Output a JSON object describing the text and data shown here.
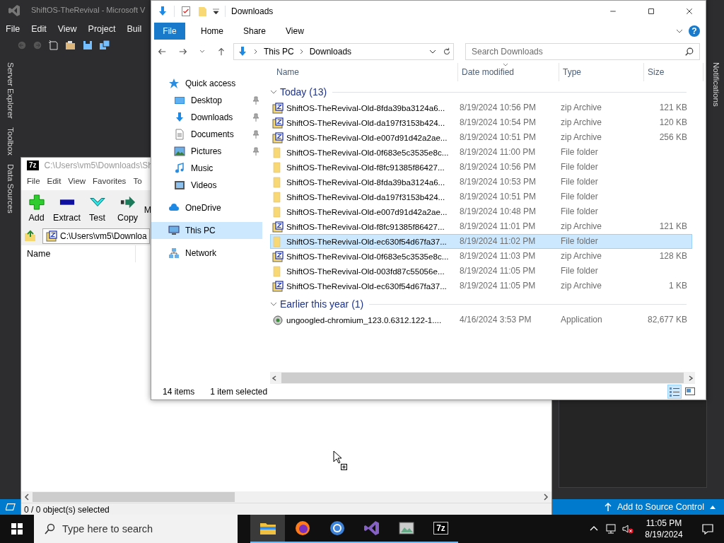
{
  "vs": {
    "title": "ShiftOS-TheRevival - Microsoft V",
    "menu": [
      "File",
      "Edit",
      "View",
      "Project",
      "Buil"
    ],
    "left_tabs": [
      "Server Explorer",
      "Toolbox",
      "Data Sources"
    ],
    "right_tabs": [
      "Notifications"
    ],
    "status_action": "Add to Source Control"
  },
  "sevenzip": {
    "logo": "7z",
    "title": "C:\\Users\\vm5\\Downloads\\Sh",
    "menu": [
      "File",
      "Edit",
      "View",
      "Favorites",
      "To"
    ],
    "toolbar": [
      {
        "kind": "add",
        "label": "Add"
      },
      {
        "kind": "extract",
        "label": "Extract"
      },
      {
        "kind": "test",
        "label": "Test"
      },
      {
        "kind": "copy",
        "label": "Copy"
      },
      {
        "kind": "move",
        "label": "M"
      }
    ],
    "address": "C:\\Users\\vm5\\Downloa",
    "columns": [
      "Name"
    ],
    "status": "0 / 0 object(s) selected"
  },
  "explorer": {
    "title": "Downloads",
    "ribbon_tabs": [
      {
        "kind": "file-menu",
        "label": "File"
      },
      {
        "kind": "tab",
        "label": "Home"
      },
      {
        "kind": "tab",
        "label": "Share"
      },
      {
        "kind": "tab",
        "label": "View"
      }
    ],
    "help": "?",
    "breadcrumb": [
      "This PC",
      "Downloads"
    ],
    "search": {
      "placeholder": "Search Downloads"
    },
    "nav": [
      {
        "label": "Quick access",
        "kind": "star",
        "selected": false,
        "children": [
          {
            "label": "Desktop",
            "kind": "desktop",
            "pinned": true,
            "selected": false
          },
          {
            "label": "Downloads",
            "kind": "downloads",
            "pinned": true,
            "selected": false
          },
          {
            "label": "Documents",
            "kind": "documents",
            "pinned": true,
            "selected": false
          },
          {
            "label": "Pictures",
            "kind": "pictures",
            "pinned": true,
            "selected": false
          },
          {
            "label": "Music",
            "kind": "music",
            "pinned": false,
            "selected": false
          },
          {
            "label": "Videos",
            "kind": "videos",
            "pinned": false,
            "selected": false
          }
        ]
      },
      {
        "label": "OneDrive",
        "kind": "cloud",
        "selected": false
      },
      {
        "label": "This PC",
        "kind": "pc",
        "selected": true
      },
      {
        "label": "Network",
        "kind": "network",
        "selected": false
      }
    ],
    "columns": [
      "Name",
      "Date modified",
      "Type",
      "Size"
    ],
    "groups": [
      {
        "label": "Today (13)",
        "items": [
          {
            "kind": "zip",
            "name": "ShiftOS-TheRevival-Old-8fda39ba3124a6...",
            "date": "8/19/2024 10:56 PM",
            "type": "zip Archive",
            "size": "121 KB",
            "selected": false
          },
          {
            "kind": "zip",
            "name": "ShiftOS-TheRevival-Old-da197f3153b424...",
            "date": "8/19/2024 10:54 PM",
            "type": "zip Archive",
            "size": "120 KB",
            "selected": false
          },
          {
            "kind": "zip",
            "name": "ShiftOS-TheRevival-Old-e007d91d42a2ae...",
            "date": "8/19/2024 10:51 PM",
            "type": "zip Archive",
            "size": "256 KB",
            "selected": false
          },
          {
            "kind": "folder",
            "name": "ShiftOS-TheRevival-Old-0f683e5c3535e8c...",
            "date": "8/19/2024 11:00 PM",
            "type": "File folder",
            "selected": false
          },
          {
            "kind": "folder",
            "name": "ShiftOS-TheRevival-Old-f8fc91385f86427...",
            "date": "8/19/2024 10:56 PM",
            "type": "File folder",
            "selected": false
          },
          {
            "kind": "folder",
            "name": "ShiftOS-TheRevival-Old-8fda39ba3124a6...",
            "date": "8/19/2024 10:53 PM",
            "type": "File folder",
            "selected": false
          },
          {
            "kind": "folder",
            "name": "ShiftOS-TheRevival-Old-da197f3153b424...",
            "date": "8/19/2024 10:51 PM",
            "type": "File folder",
            "selected": false
          },
          {
            "kind": "folder",
            "name": "ShiftOS-TheRevival-Old-e007d91d42a2ae...",
            "date": "8/19/2024 10:48 PM",
            "type": "File folder",
            "selected": false
          },
          {
            "kind": "zip",
            "name": "ShiftOS-TheRevival-Old-f8fc91385f86427...",
            "date": "8/19/2024 11:01 PM",
            "type": "zip Archive",
            "size": "121 KB",
            "selected": false
          },
          {
            "kind": "folder",
            "name": "ShiftOS-TheRevival-Old-ec630f54d67fa37...",
            "date": "8/19/2024 11:02 PM",
            "type": "File folder",
            "selected": true
          },
          {
            "kind": "zip",
            "name": "ShiftOS-TheRevival-Old-0f683e5c3535e8c...",
            "date": "8/19/2024 11:03 PM",
            "type": "zip Archive",
            "size": "128 KB",
            "selected": false
          },
          {
            "kind": "folder",
            "name": "ShiftOS-TheRevival-Old-003fd87c55056e...",
            "date": "8/19/2024 11:05 PM",
            "type": "File folder",
            "selected": false
          },
          {
            "kind": "zip",
            "name": "ShiftOS-TheRevival-Old-ec630f54d67fa37...",
            "date": "8/19/2024 11:05 PM",
            "type": "zip Archive",
            "size": "1 KB",
            "selected": false
          }
        ]
      },
      {
        "label": "Earlier this year (1)",
        "items": [
          {
            "kind": "app",
            "name": "ungoogled-chromium_123.0.6312.122-1....",
            "date": "4/16/2024 3:53 PM",
            "type": "Application",
            "size": "82,677 KB",
            "selected": false
          }
        ]
      }
    ],
    "status": {
      "count": "14 items",
      "selection": "1 item selected"
    },
    "views": [
      {
        "kind": "details",
        "selected": true
      },
      {
        "kind": "large-icons",
        "selected": false
      }
    ]
  },
  "taskbar": {
    "search": {
      "placeholder": "Type here to search"
    },
    "apps": [
      {
        "kind": "explorer",
        "active": true
      },
      {
        "kind": "firefox",
        "active": false
      },
      {
        "kind": "chromium",
        "active": false
      },
      {
        "kind": "visual-studio",
        "active": false
      },
      {
        "kind": "image-app",
        "active": false
      },
      {
        "kind": "sevenzip",
        "label": "7z",
        "active": false
      }
    ],
    "time": "11:05 PM",
    "date": "8/19/2024"
  }
}
